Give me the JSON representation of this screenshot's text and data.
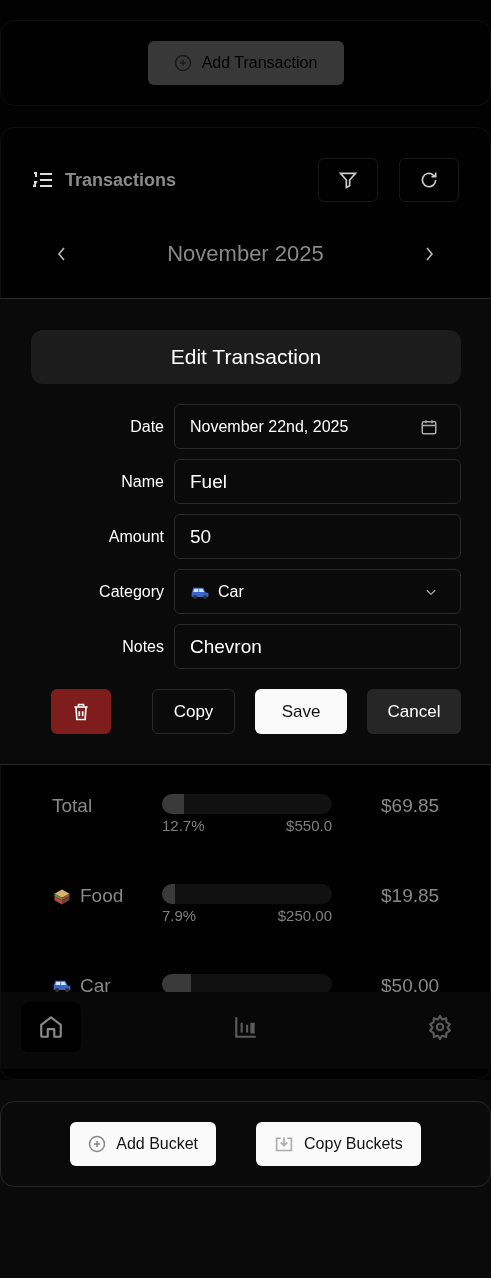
{
  "top_card": {
    "add_button": "Add Transaction"
  },
  "transactions": {
    "title": "Transactions",
    "month": "November 2025",
    "buckets": [
      {
        "name": "Total",
        "kind": "plain",
        "level": 0.127,
        "percent": "12.7%",
        "budget": "$550.0",
        "spent": "$69.85"
      },
      {
        "name": "Food",
        "kind": "box",
        "level": 0.079,
        "percent": "7.9%",
        "budget": "$250.00",
        "spent": "$19.85"
      },
      {
        "name": "Car",
        "kind": "car",
        "level": 0.17,
        "spent": "$50.00"
      }
    ],
    "nav": [
      {
        "kind": "home",
        "selected": true
      },
      {
        "kind": "chart",
        "selected": false
      },
      {
        "kind": "settings",
        "selected": false
      }
    ]
  },
  "dialog": {
    "title": "Edit Transaction",
    "fields": [
      {
        "label": "Date",
        "value": "November 22nd, 2025",
        "kind": "date"
      },
      {
        "label": "Name",
        "value": "Fuel",
        "kind": "text"
      },
      {
        "label": "Amount",
        "value": "50",
        "kind": "text"
      },
      {
        "label": "Category",
        "value": "Car",
        "kind": "select"
      },
      {
        "label": "Notes",
        "value": "Chevron",
        "kind": "text"
      }
    ],
    "actions": [
      {
        "kind": "delete"
      },
      {
        "kind": "outline",
        "label": "Copy"
      },
      {
        "kind": "primary",
        "label": "Save"
      },
      {
        "kind": "secondary",
        "label": "Cancel"
      }
    ]
  },
  "bottom_card": {
    "buttons": [
      {
        "label": "Add Bucket",
        "kind": "add"
      },
      {
        "label": "Copy Buckets",
        "kind": "copy"
      }
    ]
  }
}
